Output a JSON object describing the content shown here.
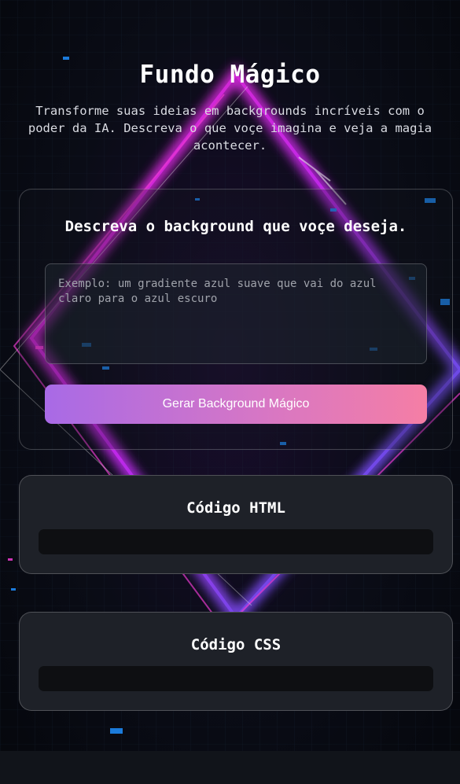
{
  "header": {
    "title": "Fundo Mágico",
    "subtitle": "Transforme suas ideias em backgrounds incríveis com o poder da IA. Descreva o que voçe imagina e veja a magia acontecer."
  },
  "form": {
    "title": "Descreva o background que voçe deseja.",
    "placeholder": "Exemplo: um gradiente azul suave que vai do azul claro para o azul escuro",
    "value": "",
    "button_label": "Gerar Background Mágico"
  },
  "html_output": {
    "title": "Código HTML",
    "code": ""
  },
  "css_output": {
    "title": "Código CSS",
    "code": ""
  },
  "colors": {
    "accent_start": "#a86ae6",
    "accent_end": "#f57ea5",
    "card_bg": "#1e2128",
    "page_bg": "#0b0d14",
    "neon_pink": "#ff2bd6",
    "neon_blue": "#3b6bff"
  }
}
